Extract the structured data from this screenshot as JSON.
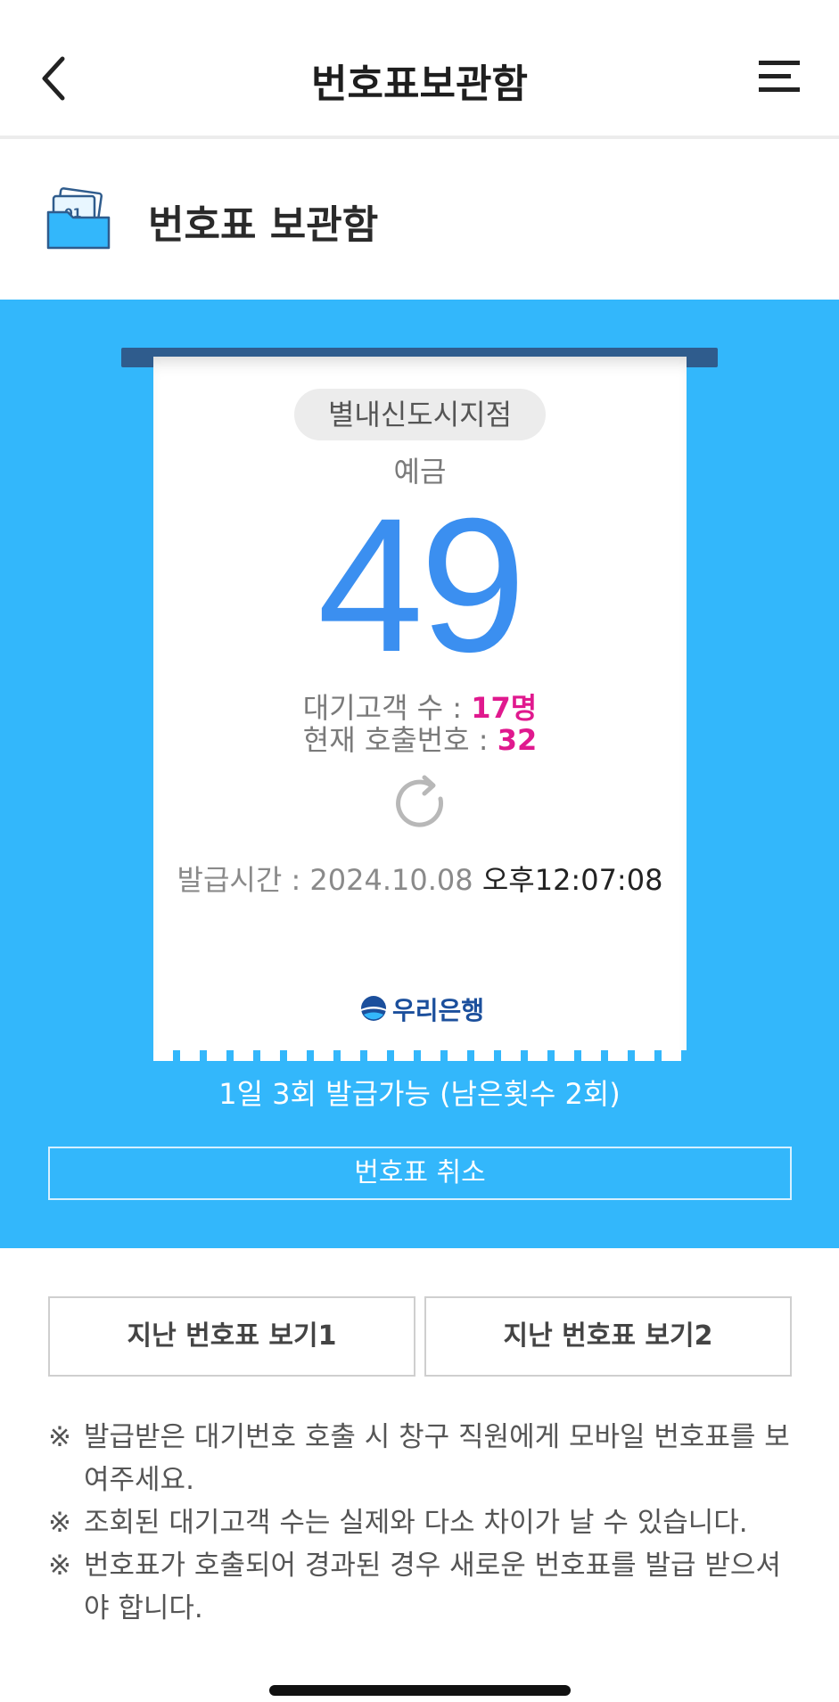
{
  "header": {
    "title": "번호표보관함"
  },
  "section": {
    "title": "번호표 보관함"
  },
  "ticket": {
    "branch": "별내신도시지점",
    "service": "예금",
    "number": "49",
    "wait_label": "대기고객 수 : ",
    "wait_value": "17명",
    "call_label": "현재 호출번호 : ",
    "call_value": "32",
    "issue_label": "발급시간 : 2024.10.08 ",
    "issue_ampm": "오후12:07:08",
    "bank_name": "우리은행"
  },
  "quota_text": "1일 3회 발급가능 (남은횟수 2회)",
  "cancel_label": "번호표 취소",
  "past_buttons": [
    "지난 번호표 보기1",
    "지난 번호표 보기2"
  ],
  "notes": [
    {
      "mark": "※",
      "text": "발급받은 대기번호 호출 시 창구 직원에게 모바일 번호표를 보여주세요."
    },
    {
      "mark": "※",
      "text": "조회된 대기고객 수는 실제와 다소 차이가 날 수 있습니다."
    },
    {
      "mark": "※",
      "text": "번호표가 호출되어 경과된 경우 새로운 번호표를 발급 받으셔야 합니다."
    }
  ],
  "colors": {
    "accent_blue": "#33b7fb",
    "number_blue": "#3b8ff0",
    "highlight_magenta": "#e0198e",
    "roller_navy": "#2f5c8d"
  },
  "icons": {
    "back": "chevron-left-icon",
    "menu": "hamburger-menu-icon",
    "folder": "ticket-folder-icon",
    "refresh": "refresh-icon",
    "logo": "woori-bank-logo-icon"
  }
}
